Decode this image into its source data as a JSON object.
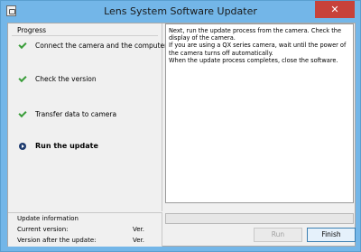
{
  "window": {
    "title": "Lens System Software Updater",
    "close_glyph": "✕"
  },
  "progress_panel": {
    "label": "Progress",
    "steps": [
      {
        "label": "Connect the camera and the computer",
        "status": "done",
        "icon": "check-icon"
      },
      {
        "label": "Check the version",
        "status": "done",
        "icon": "check-icon"
      },
      {
        "label": "Transfer data to camera",
        "status": "done",
        "icon": "check-icon"
      },
      {
        "label": "Run the update",
        "status": "current",
        "icon": "current-step-icon"
      }
    ]
  },
  "update_info": {
    "title": "Update information",
    "current_version_label": "Current version:",
    "current_version_value": "Ver.",
    "after_version_label": "Version after the update:",
    "after_version_value": "Ver."
  },
  "message": {
    "lines": [
      "Next, run the update process from the camera. Check the display of the camera.",
      "If you are using a QX series camera, wait until the power of the camera turns off automatically.",
      "When the update process completes, close the software."
    ]
  },
  "progress_bar": {
    "value": 0
  },
  "buttons": {
    "run_label": "Run",
    "finish_label": "Finish"
  },
  "colors": {
    "titlebar": "#73b6e8",
    "close_button": "#c7423a",
    "check": "#3a9d3a"
  }
}
